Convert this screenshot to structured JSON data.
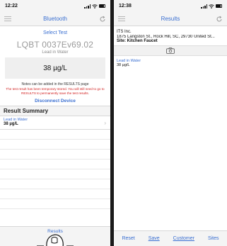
{
  "left": {
    "status": {
      "time": "12:22"
    },
    "nav": {
      "title": "Bluetooth"
    },
    "select_test": "Select Test",
    "device_serial": "LQBT  0037Ev69.02",
    "measurement": "Lead in Water",
    "reading": "38 µg/L",
    "notes_hint": "Notes can be added in the RESULTS page",
    "warning": "The test result has been temporary stored.  You will still need to go to RESULTS to permanently save the test results.",
    "disconnect": "Disconnect Device",
    "summary": {
      "header": "Result Summary",
      "items": [
        {
          "measurement": "Lead in Water",
          "value": "38 µg/L"
        }
      ]
    },
    "bottom": {
      "results": "Results"
    }
  },
  "right": {
    "status": {
      "time": "12:38"
    },
    "nav": {
      "title": "Results"
    },
    "company": "ITS Inc.",
    "address": "1875 Langston St., Rock Hill, SC, 29730 United St...",
    "site": "Site: Kitchen Faucet",
    "result": {
      "measurement": "Lead in Water",
      "value": "38 µg/L"
    },
    "toolbar": {
      "reset": "Reset",
      "save": "Save",
      "customer": "Customer",
      "sites": "Sites"
    }
  },
  "colors": {
    "accent": "#3a6fd1",
    "warning": "#d22020"
  },
  "icons": [
    "hamburger-menu-icon",
    "refresh-icon",
    "camera-icon",
    "chevron-right-icon",
    "signal-icon",
    "wifi-icon",
    "battery-icon",
    "location-arrow-icon",
    "finger-tap-icon"
  ]
}
